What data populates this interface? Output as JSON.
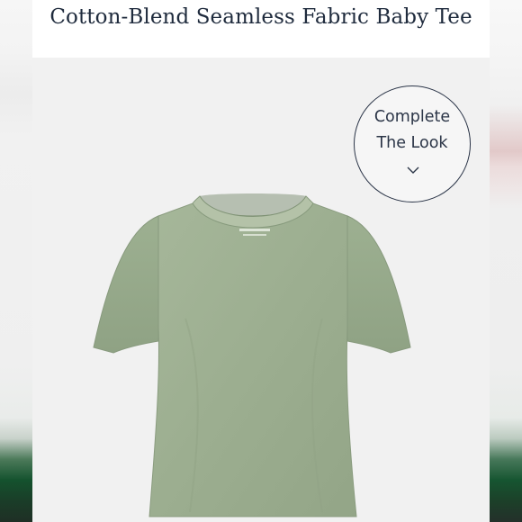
{
  "product": {
    "title": "Cotton-Blend Seamless Fabric Baby Tee",
    "image_alt": "sage green baby tee"
  },
  "complete_look": {
    "line1": "Complete",
    "line2": "The Look",
    "icon": "chevron-down-icon"
  },
  "colors": {
    "title": "#1f2b3d",
    "stage_background": "#f1f1f1",
    "tee": "#9fb193"
  }
}
